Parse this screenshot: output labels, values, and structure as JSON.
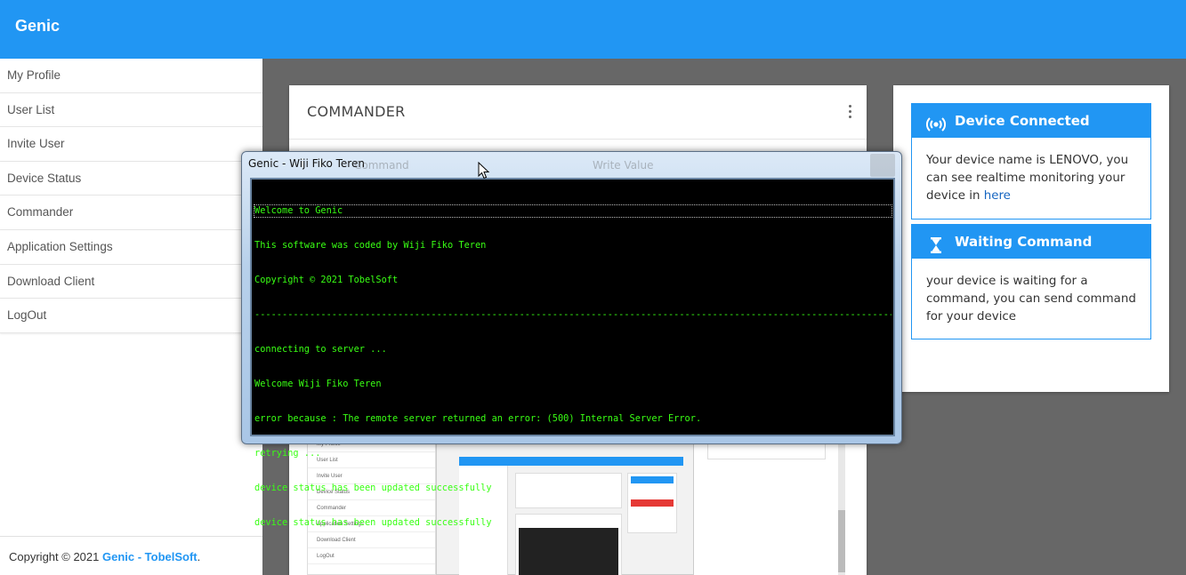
{
  "app": {
    "brand": "Genic"
  },
  "sidebar": {
    "items": [
      {
        "label": "My Profile"
      },
      {
        "label": "User List"
      },
      {
        "label": "Invite User"
      },
      {
        "label": "Device Status"
      },
      {
        "label": "Commander"
      },
      {
        "label": "Application Settings"
      },
      {
        "label": "Download Client"
      },
      {
        "label": "LogOut"
      }
    ],
    "footer": {
      "prefix": "Copyright © 2021 ",
      "link": "Genic - TobelSoft",
      "suffix": "."
    }
  },
  "commander": {
    "title": "COMMANDER",
    "ghost_left": "Command",
    "ghost_right": "Write Value"
  },
  "preview": {
    "nav": [
      "My Profile",
      "User List",
      "Invite User",
      "Device Status",
      "Commander",
      "Application Settings",
      "Download Client",
      "LogOut"
    ]
  },
  "info": {
    "connected": {
      "title": "Device Connected",
      "icon": "broadcast-icon",
      "text": "Your device name is LENOVO, you can see realtime monitoring your device in ",
      "link": "here"
    },
    "waiting": {
      "title": "Waiting Command",
      "icon": "hourglass-icon",
      "text": "your device is waiting for a command, you can send command for your device"
    }
  },
  "console": {
    "title": "Genic - Wiji Fiko Teren",
    "lines": [
      "Welcome to Genic",
      "This software was coded by Wiji Fiko Teren",
      "Copyright © 2021 TobelSoft",
      "--------------------------------------------------------------------------------------------------------------------------",
      "connecting to server ...",
      "Welcome Wiji Fiko Teren",
      "error because : The remote server returned an error: (500) Internal Server Error.",
      "retrying ...",
      "device status has been updated successfully",
      "device status has been updated successfully"
    ]
  },
  "colors": {
    "primary": "#2196f3",
    "console_text": "#39ff14"
  }
}
